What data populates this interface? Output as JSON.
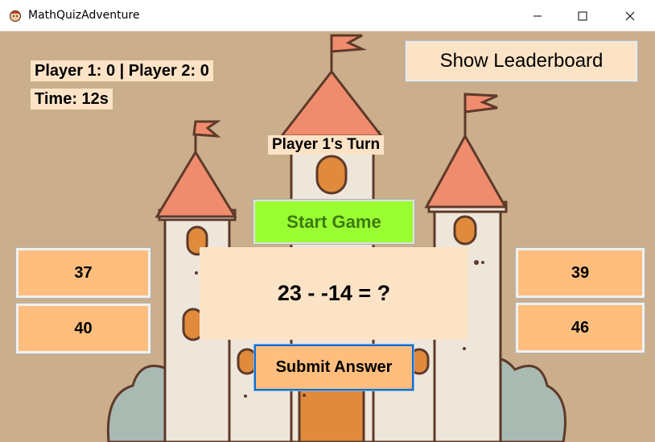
{
  "window": {
    "title": "MathQuizAdventure",
    "icon": "app-icon"
  },
  "scoreboard": {
    "scores_text": "Player 1: 0 | Player 2: 0",
    "timer_text": "Time: 12s",
    "turn_text": "Player 1's Turn"
  },
  "buttons": {
    "leaderboard_label": "Show Leaderboard",
    "start_label": "Start Game",
    "submit_label": "Submit Answer"
  },
  "question": {
    "text": "23 - -14 = ?"
  },
  "answers": [
    "37",
    "40",
    "39",
    "46"
  ],
  "colors": {
    "background": "#cbae8b",
    "panel": "#fde3c6",
    "answer_button": "#ffbe7d",
    "start_button": "#99ff33",
    "start_text": "#3d7a10",
    "focus_border": "#0a6fd6"
  }
}
